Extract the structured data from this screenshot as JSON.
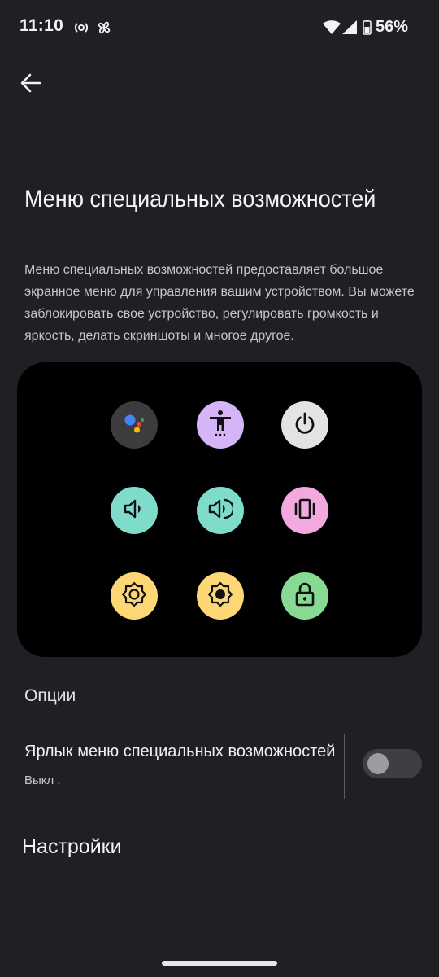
{
  "status_bar": {
    "time": "11:10",
    "battery_percent": "56%",
    "icons": [
      "hotspot-icon",
      "pinwheel-icon",
      "wifi-icon",
      "cellular-signal-icon",
      "battery-icon"
    ]
  },
  "header": {
    "back_icon": "arrow-left-icon",
    "title": "Меню специальных возможностей"
  },
  "description": "Меню специальных возможностей предоставляет большое экранное меню для управления вашим устройством. Вы можете заблокировать свое устройство, регулировать громкость и яркость, делать скриншоты и многое другое.",
  "preview": {
    "items": [
      {
        "icon": "google-assistant-icon",
        "color": "#3c3c3f"
      },
      {
        "icon": "accessibility-person-icon",
        "color": "#d5b5f7"
      },
      {
        "icon": "power-icon",
        "color": "#e3e3e3"
      },
      {
        "icon": "volume-down-icon",
        "color": "#7fdccb"
      },
      {
        "icon": "volume-up-icon",
        "color": "#7fdccb"
      },
      {
        "icon": "vibrate-icon",
        "color": "#f3a9dd"
      },
      {
        "icon": "brightness-low-icon",
        "color": "#fdd675"
      },
      {
        "icon": "brightness-high-icon",
        "color": "#fdd675"
      },
      {
        "icon": "lock-icon",
        "color": "#86da94"
      }
    ]
  },
  "options": {
    "section_title": "Опции",
    "shortcut_title": "Ярлык меню специальных возможностей",
    "shortcut_summary": "Выкл .",
    "shortcut_enabled": false
  },
  "settings": {
    "section_title": "Настройки"
  },
  "colors": {
    "background": "#1f2023",
    "card": "#000000",
    "toggle_track_off": "#3d3f43"
  }
}
